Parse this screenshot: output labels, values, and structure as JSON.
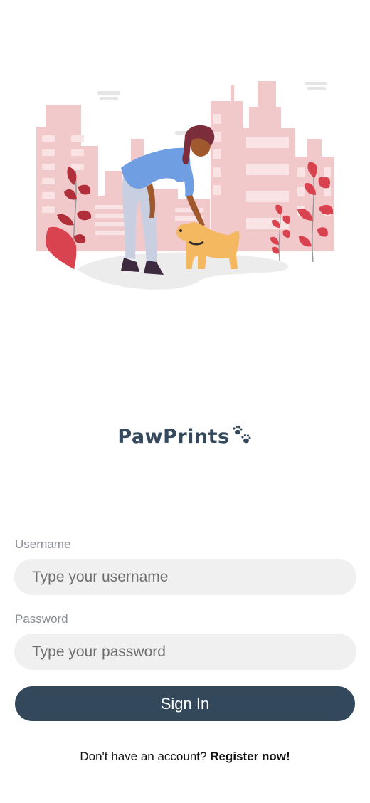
{
  "app": {
    "logo_text": "PawPrints"
  },
  "login_form": {
    "username_label": "Username",
    "username_placeholder": "Type your username",
    "username_value": "",
    "password_label": "Password",
    "password_placeholder": "Type your password",
    "password_value": "",
    "signin_label": "Sign In"
  },
  "register": {
    "prompt": "Don't have an account?",
    "link_label": "Register now!"
  },
  "colors": {
    "brand": "#34495e",
    "button": "#33495b",
    "input_bg": "#f0f0f0",
    "illustration_buildings": "#f2c9ca",
    "illustration_leaves": "#d9434f"
  },
  "icons": {
    "logo_mark": "paw-prints-icon"
  }
}
